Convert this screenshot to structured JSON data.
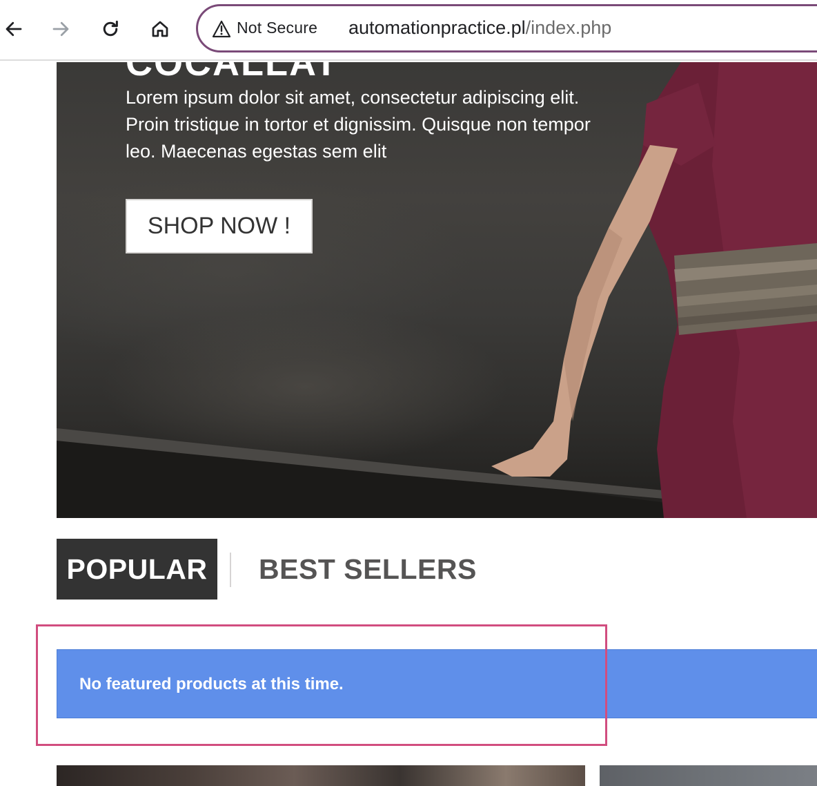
{
  "browser": {
    "security_label": "Not Secure",
    "url_host": "automationpractice.pl",
    "url_path": "/index.php"
  },
  "hero": {
    "heading_partial": "COCALLAT",
    "description": "Lorem ipsum dolor sit amet, consectetur adipiscing elit. Proin tristique in tortor et dignissim. Quisque non tempor leo. Maecenas egestas sem elit",
    "cta_label": "SHOP NOW !"
  },
  "tabs": [
    {
      "label": "POPULAR",
      "active": true
    },
    {
      "label": "BEST SELLERS",
      "active": false
    }
  ],
  "alert": {
    "message": "No featured products at this time."
  },
  "colors": {
    "accent_highlight": "#d14d7f",
    "alert_bg": "#5f8fea",
    "tab_active_bg": "#333333",
    "omnibox_border": "#7a4a78"
  },
  "icons": [
    "back-arrow-icon",
    "forward-arrow-icon",
    "reload-icon",
    "home-icon",
    "warning-triangle-icon"
  ]
}
